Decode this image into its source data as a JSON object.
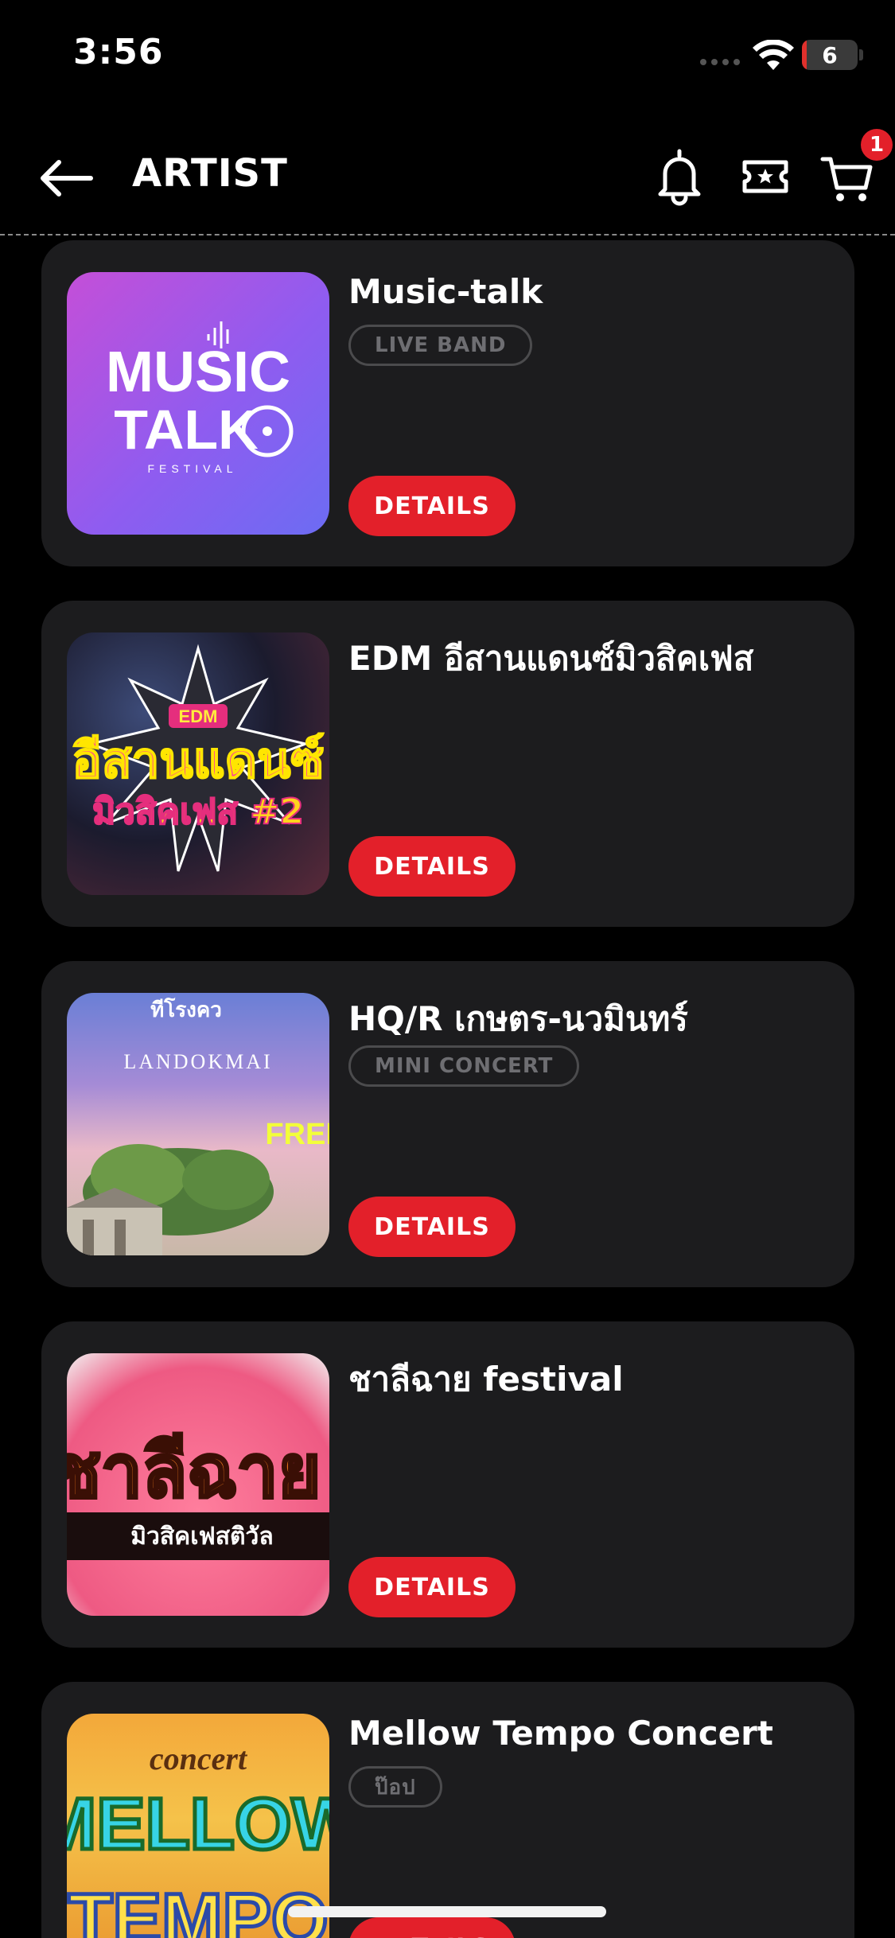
{
  "status_bar": {
    "time": "3:56",
    "battery_level": "6",
    "battery_fraction": 0.06
  },
  "header": {
    "title": "ARTIST",
    "cart_badge": "1",
    "icons": [
      "back-arrow-icon",
      "bell-icon",
      "ticket-icon",
      "cart-icon"
    ]
  },
  "artists": [
    {
      "name": "Music-talk",
      "genre": "LIVE BAND",
      "details_label": "DETAILS",
      "thumb_text": {
        "line1": "MUSIC",
        "line2": "TALK",
        "line3": "FESTIVAL"
      }
    },
    {
      "name": "EDM อีสานแดนซ์มิวสิคเฟส",
      "genre": "",
      "details_label": "DETAILS",
      "thumb_text": {
        "line1": "EDM",
        "line2": "อีสานแดนซ์",
        "line3": "มิวสิคเฟส #2"
      }
    },
    {
      "name": "HQ/R เกษตร-นวมินทร์",
      "genre": "MINI CONCERT",
      "details_label": "DETAILS",
      "thumb_text": {
        "line1": "ทีโรงคว",
        "line2": "LANDOKMAI",
        "line3": "FREE"
      }
    },
    {
      "name": "ชาลีฉาย festival",
      "genre": "",
      "details_label": "DETAILS",
      "thumb_text": {
        "line1": "ชาลีฉาย",
        "line2": "มิวสิคเฟสติวัล"
      }
    },
    {
      "name": "Mellow Tempo Concert",
      "genre": "ป๊อป",
      "details_label": "DETAILS",
      "thumb_text": {
        "line1": "concert",
        "line2": "MELLOW",
        "line3": "TEMPO"
      }
    }
  ],
  "colors": {
    "accent": "#e3202a",
    "card_bg": "#1c1c1e",
    "background": "#000000"
  }
}
